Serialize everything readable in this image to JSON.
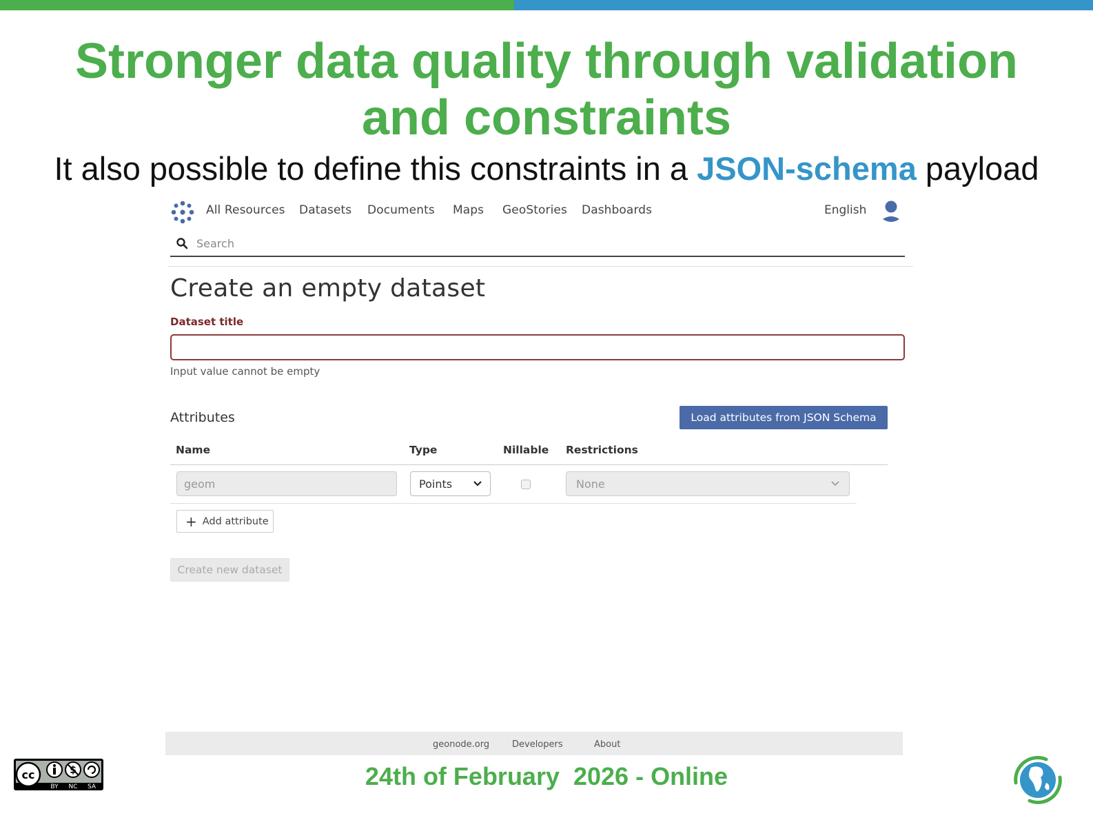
{
  "slide": {
    "title": "Stronger data quality through validation and constraints",
    "subtitle_before": "It also possible to define this constraints in a ",
    "subtitle_highlight": "JSON-schema",
    "subtitle_after": " payload",
    "event": "24th of February  2026 - Online",
    "license_badge": "CC BY NC SA"
  },
  "nav": {
    "items": [
      "All Resources",
      "Datasets",
      "Documents",
      "Maps",
      "GeoStories",
      "Dashboards"
    ],
    "language": "English"
  },
  "search": {
    "placeholder": "Search",
    "value": ""
  },
  "form": {
    "page_title": "Create an empty dataset",
    "dataset_title_label": "Dataset title",
    "dataset_title_value": "",
    "error_message": "Input value cannot be empty",
    "attributes_heading": "Attributes",
    "load_button": "Load attributes from JSON Schema",
    "columns": [
      "Name",
      "Type",
      "Nillable",
      "Restrictions"
    ],
    "row": {
      "name": "geom",
      "type": "Points",
      "nillable": false,
      "restrictions": "None"
    },
    "add_attribute": "Add attribute",
    "create_button": "Create new dataset"
  },
  "footer": {
    "links": [
      "geonode.org",
      "Developers",
      "About"
    ]
  },
  "colors": {
    "green": "#4cae4c",
    "blue": "#3595c9",
    "button_blue": "#4a6aa8",
    "error_red": "#8a3a3a"
  }
}
